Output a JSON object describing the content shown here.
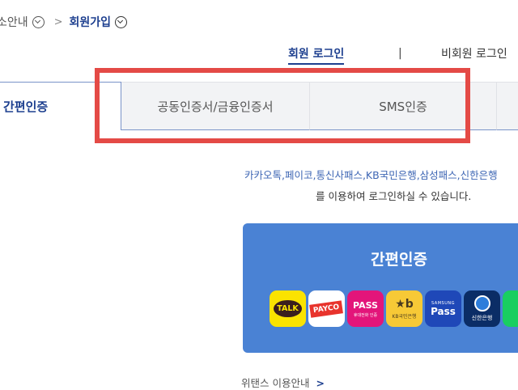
{
  "breadcrumb": {
    "previous": "소안내",
    "current": "회원가입"
  },
  "login_links": {
    "member": "회원 로그인",
    "divider": "|",
    "nonmember": "비회원 로그인"
  },
  "tabs": [
    {
      "label": "간편인증",
      "active": true
    },
    {
      "label": "공동인증서/금융인증서",
      "active": false
    },
    {
      "label": "SMS인증",
      "active": false
    }
  ],
  "description": {
    "line1": "카카오톡,페이코,통신사패스,KB국민은행,삼성패스,신한은행",
    "line2": "를 이용하여 로그인하실 수 있습니다."
  },
  "panel": {
    "title": "간편인증",
    "color": "#4a82d4",
    "icons": [
      {
        "name": "kakao-talk-icon",
        "text": "TALK"
      },
      {
        "name": "payco-icon",
        "text": "PAYCO"
      },
      {
        "name": "pass-icon",
        "text": "PASS",
        "subtext": "휴대전화 인증"
      },
      {
        "name": "kb-icon",
        "text": "★b",
        "subtext": "KB국민은행"
      },
      {
        "name": "samsung-pass-icon",
        "text": "Pass",
        "subtext": "SAMSUNG"
      },
      {
        "name": "shinhan-icon",
        "subtext": "신한은행"
      },
      {
        "name": "green-app-icon"
      }
    ]
  },
  "footer": {
    "link": "위탠스 이용안내",
    "arrow": ">"
  },
  "colors": {
    "accent": "#1d3f8f",
    "highlight": "#e44a46"
  }
}
